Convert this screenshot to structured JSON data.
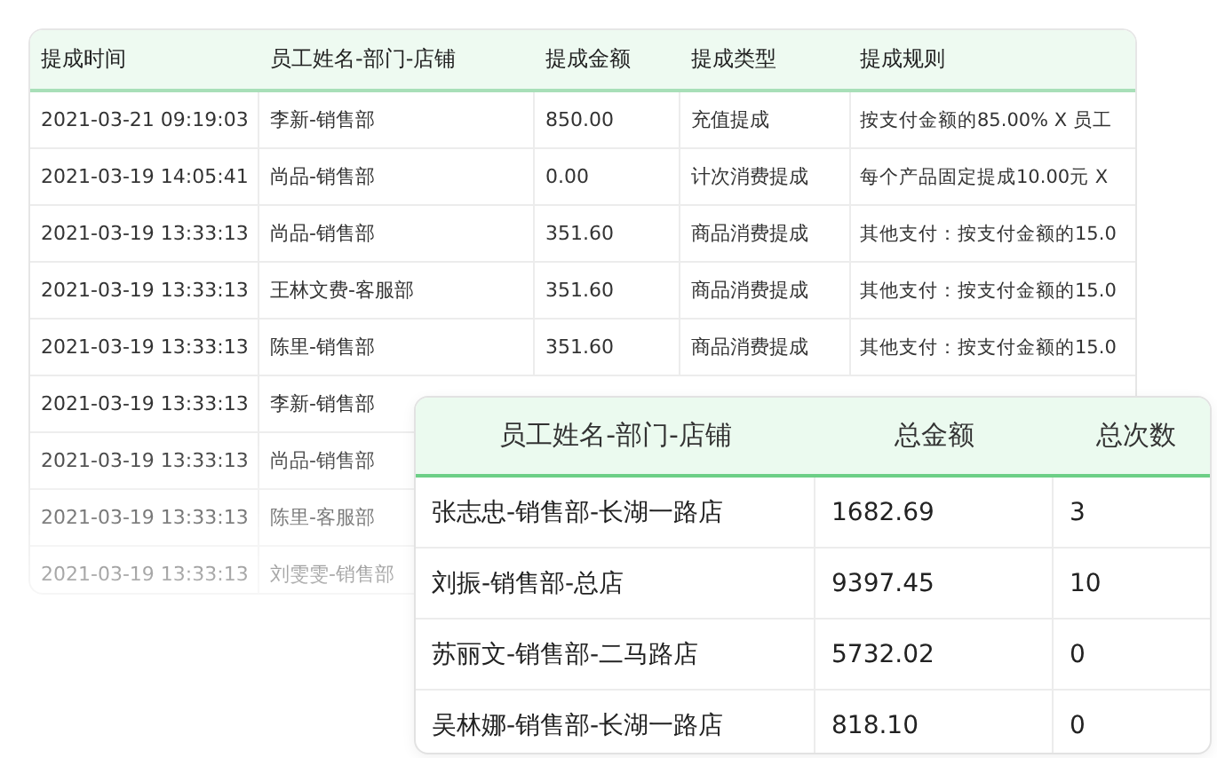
{
  "commission_table": {
    "columns": [
      "提成时间",
      "员工姓名-部门-店铺",
      "提成金额",
      "提成类型",
      "提成规则"
    ],
    "rows": [
      {
        "cells": [
          "2021-03-21 09:19:03",
          "李新-销售部",
          "850.00",
          "充值提成",
          "按支付金额的85.00% X 员工"
        ]
      },
      {
        "cells": [
          "2021-03-19 14:05:41",
          "尚品-销售部",
          "0.00",
          "计次消费提成",
          "每个产品固定提成10.00元 X"
        ]
      },
      {
        "cells": [
          "2021-03-19 13:33:13",
          "尚品-销售部",
          "351.60",
          "商品消费提成",
          "其他支付：按支付金额的15.0"
        ]
      },
      {
        "cells": [
          "2021-03-19 13:33:13",
          "王林文费-客服部",
          "351.60",
          "商品消费提成",
          "其他支付：按支付金额的15.0"
        ]
      },
      {
        "cells": [
          "2021-03-19 13:33:13",
          "陈里-销售部",
          "351.60",
          "商品消费提成",
          "其他支付：按支付金额的15.0"
        ]
      },
      {
        "cells": [
          "2021-03-19 13:33:13",
          "李新-销售部"
        ]
      },
      {
        "cells": [
          "2021-03-19 13:33:13",
          "尚品-销售部"
        ]
      },
      {
        "cells": [
          "2021-03-19 13:33:13",
          "陈里-客服部"
        ]
      },
      {
        "cells": [
          "2021-03-19 13:33:13",
          "刘雯雯-销售部"
        ]
      }
    ]
  },
  "summary_table": {
    "columns": [
      "员工姓名-部门-店铺",
      "总金额",
      "总次数"
    ],
    "rows": [
      {
        "cells": [
          "张志忠-销售部-长湖一路店",
          "1682.69",
          "3"
        ]
      },
      {
        "cells": [
          "刘振-销售部-总店",
          "9397.45",
          "10"
        ]
      },
      {
        "cells": [
          "苏丽文-销售部-二马路店",
          "5732.02",
          "0"
        ]
      },
      {
        "cells": [
          "吴林娜-销售部-长湖一路店",
          "818.10",
          "0"
        ]
      }
    ]
  }
}
